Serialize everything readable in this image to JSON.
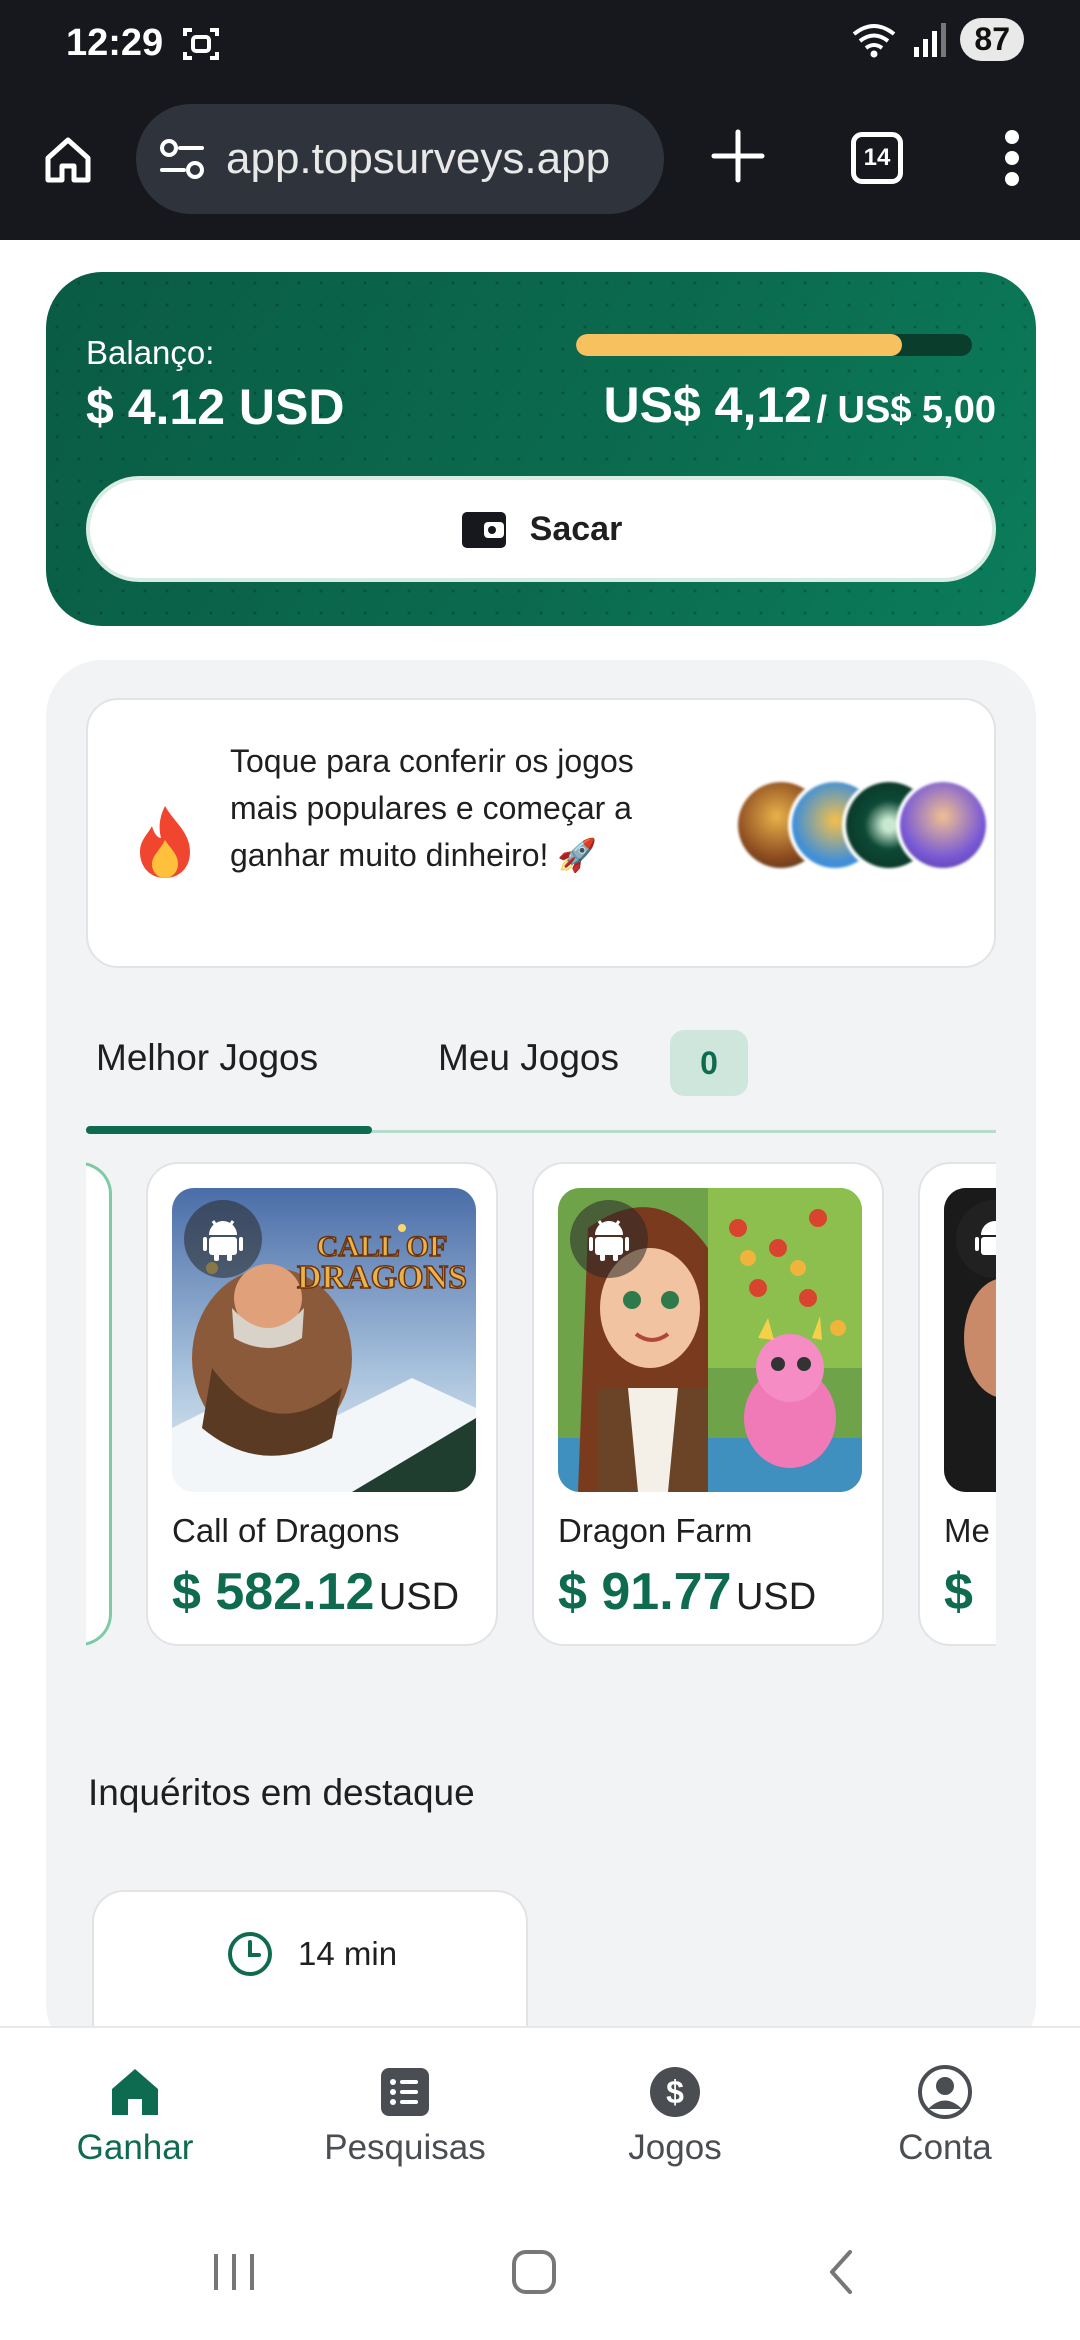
{
  "status_bar": {
    "time": "12:29",
    "battery": "87"
  },
  "browser": {
    "url": "app.topsurveys.app",
    "tab_count": "14"
  },
  "balance": {
    "label": "Balanço:",
    "value": "$ 4.12 USD",
    "goal_current": "US$ 4,12",
    "goal_target": "/ US$ 5,00",
    "progress_fraction": 0.824,
    "withdraw_label": "Sacar"
  },
  "promo": {
    "text": "Toque para conferir os jogos mais populares e começar a ganhar muito dinheiro! 🚀"
  },
  "tabs": {
    "best_label": "Melhor Jogos",
    "mine_label": "Meu Jogos",
    "mine_count": "0"
  },
  "games": [
    {
      "name": "Call of Dragons",
      "amount": "$ 582.12",
      "currency": "USD",
      "platform": "android-icon"
    },
    {
      "name": "Dragon Farm",
      "amount": "$ 91.77",
      "currency": "USD",
      "platform": "android-icon"
    },
    {
      "name": "Me",
      "amount": "$ ",
      "currency": "",
      "platform": "android-icon"
    }
  ],
  "featured": {
    "title": "Inquéritos em destaque",
    "first_survey_time": "14 min"
  },
  "bottom_nav": [
    {
      "label": "Ganhar",
      "icon": "home-icon",
      "active": true
    },
    {
      "label": "Pesquisas",
      "icon": "list-icon",
      "active": false
    },
    {
      "label": "Jogos",
      "icon": "dollar-icon",
      "active": false
    },
    {
      "label": "Conta",
      "icon": "account-icon",
      "active": false
    }
  ],
  "colors": {
    "brand": "#0f6b4f",
    "progress": "#f6c15e",
    "chrome": "#16181d"
  }
}
